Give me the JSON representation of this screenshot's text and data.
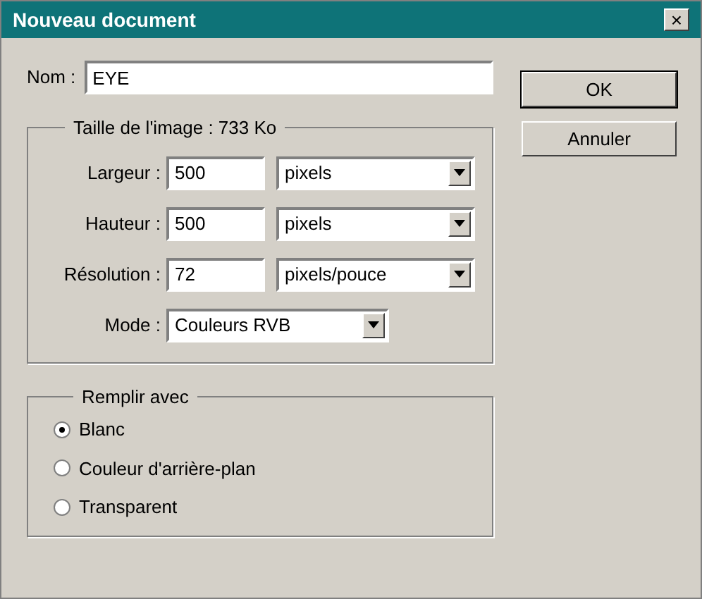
{
  "window": {
    "title": "Nouveau document",
    "close": "×"
  },
  "name": {
    "label": "Nom :",
    "value": "EYE"
  },
  "buttons": [
    {
      "label": "OK",
      "default": true
    },
    {
      "label": "Annuler",
      "default": false
    }
  ],
  "image_size": {
    "title": "Taille de l'image : 733 Ko",
    "rows": [
      {
        "label": "Largeur :",
        "kind": "field",
        "value": "500",
        "unit": "pixels"
      },
      {
        "label": "Hauteur :",
        "kind": "field",
        "value": "500",
        "unit": "pixels"
      },
      {
        "label": "Résolution :",
        "kind": "field",
        "value": "72",
        "unit": "pixels/pouce"
      },
      {
        "label": "Mode :",
        "kind": "select",
        "unit": "Couleurs RVB"
      }
    ]
  },
  "fill": {
    "title": "Remplir avec",
    "options": [
      {
        "label": "Blanc",
        "selected": true
      },
      {
        "label": "Couleur d'arrière-plan",
        "selected": false
      },
      {
        "label": "Transparent",
        "selected": false
      }
    ]
  }
}
